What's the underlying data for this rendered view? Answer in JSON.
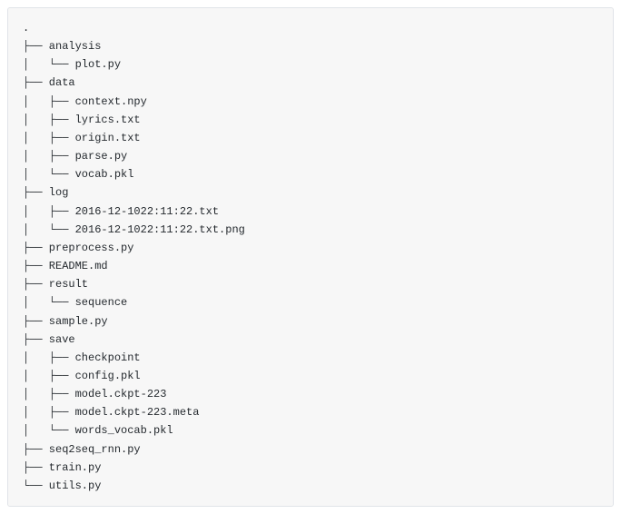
{
  "tree": {
    "lines": [
      ".",
      "├── analysis",
      "│   └── plot.py",
      "├── data",
      "│   ├── context.npy",
      "│   ├── lyrics.txt",
      "│   ├── origin.txt",
      "│   ├── parse.py",
      "│   └── vocab.pkl",
      "├── log",
      "│   ├── 2016-12-1022:11:22.txt",
      "│   └── 2016-12-1022:11:22.txt.png",
      "├── preprocess.py",
      "├── README.md",
      "├── result",
      "│   └── sequence",
      "├── sample.py",
      "├── save",
      "│   ├── checkpoint",
      "│   ├── config.pkl",
      "│   ├── model.ckpt-223",
      "│   ├── model.ckpt-223.meta",
      "│   └── words_vocab.pkl",
      "├── seq2seq_rnn.py",
      "├── train.py",
      "└── utils.py"
    ]
  }
}
